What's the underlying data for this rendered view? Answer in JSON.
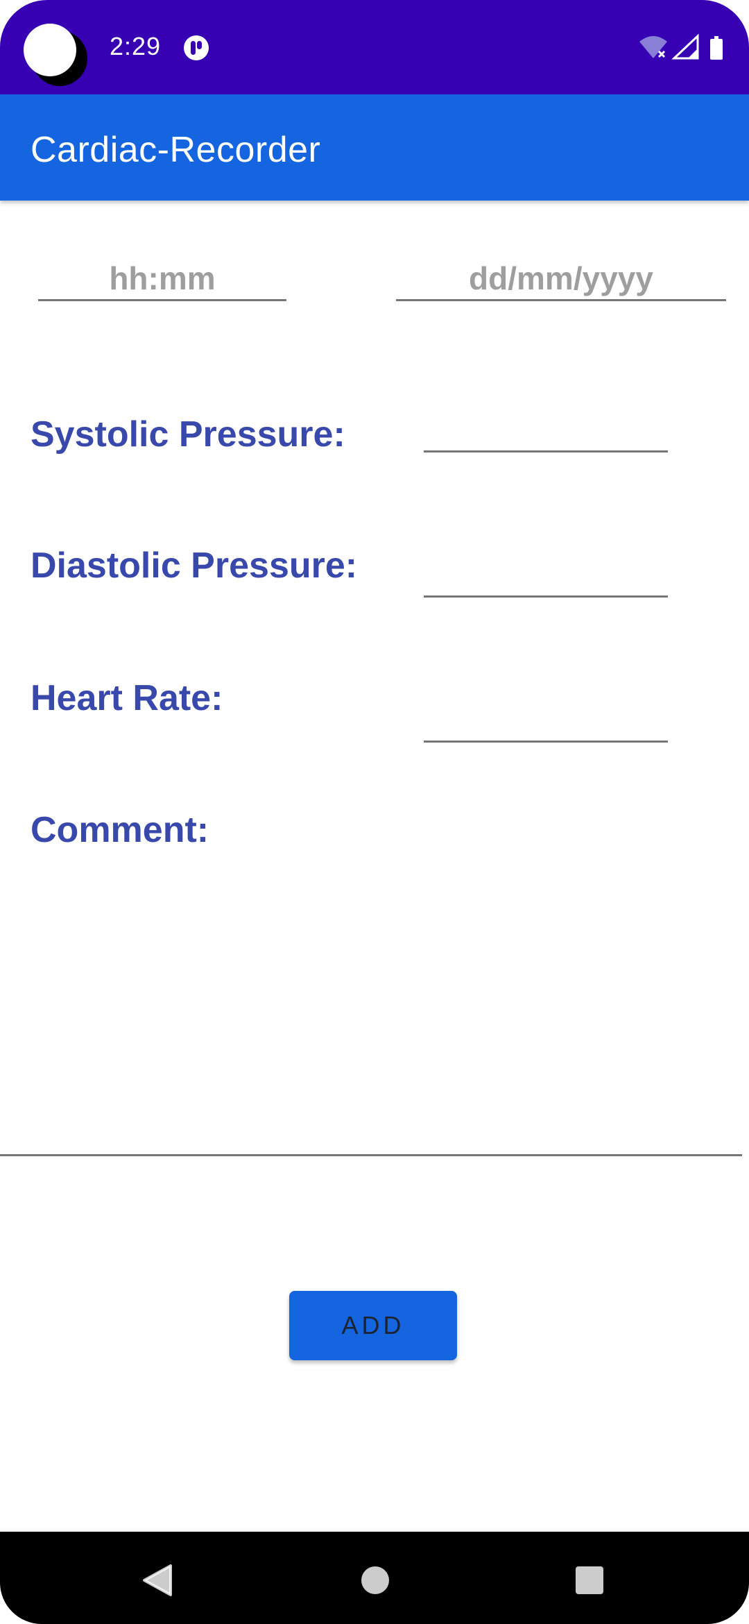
{
  "status_bar": {
    "time": "2:29",
    "app_icon": "app-notification-icon",
    "wifi_icon": "wifi-off-icon",
    "signal_icon": "cell-signal-icon",
    "battery_icon": "battery-icon",
    "background_color": "#3700b3"
  },
  "app_bar": {
    "title": "Cardiac-Recorder",
    "background_color": "#1565e0"
  },
  "form": {
    "time_field": {
      "placeholder": "hh:mm",
      "value": ""
    },
    "date_field": {
      "placeholder": "dd/mm/yyyy",
      "value": ""
    },
    "systolic": {
      "label": "Systolic Pressure:",
      "value": ""
    },
    "diastolic": {
      "label": "Diastolic Pressure:",
      "value": ""
    },
    "heart_rate": {
      "label": "Heart Rate:",
      "value": ""
    },
    "comment": {
      "label": "Comment:",
      "value": ""
    },
    "label_color": "#3949ab"
  },
  "actions": {
    "add_label": "ADD"
  },
  "nav_bar": {
    "back_icon": "back-triangle-icon",
    "home_icon": "home-circle-icon",
    "recents_icon": "recents-square-icon"
  }
}
